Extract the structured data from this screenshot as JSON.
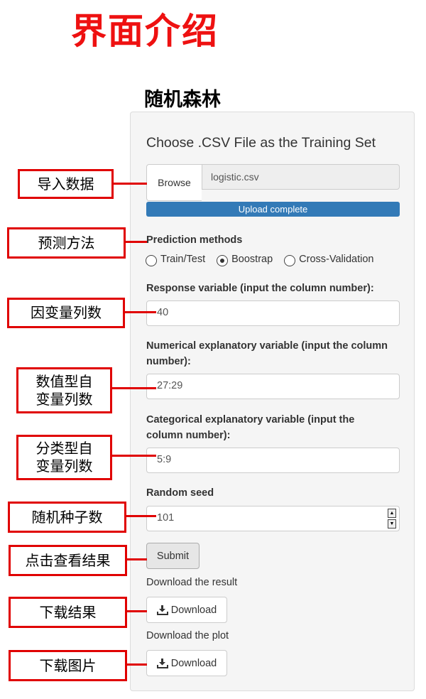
{
  "page": {
    "title": "界面介绍",
    "subtitle": "随机森林"
  },
  "panel": {
    "file_heading": "Choose .CSV File as the Training Set",
    "browse_label": "Browse",
    "file_name": "logistic.csv",
    "upload_status": "Upload complete",
    "upload_progress_percent": 100,
    "prediction_methods_label": "Prediction methods",
    "prediction_options": [
      "Train/Test",
      "Boostrap",
      "Cross-Validation"
    ],
    "prediction_selected": "Boostrap",
    "response_label": "Response variable (input the column number):",
    "response_value": "40",
    "numerical_label": "Numerical explanatory variable (input the column number):",
    "numerical_value": "27:29",
    "categorical_label": "Categorical explanatory variable (input the column number):",
    "categorical_value": "5:9",
    "seed_label": "Random seed",
    "seed_value": "101",
    "submit_label": "Submit",
    "download_result_label": "Download the result",
    "download_plot_label": "Download the plot",
    "download_button_label": "Download"
  },
  "callouts": {
    "import_data": "导入数据",
    "prediction_method": "预测方法",
    "response_columns": "因变量列数",
    "numerical_columns": "数值型自\n变量列数",
    "categorical_columns": "分类型自\n变量列数",
    "random_seed": "随机种子数",
    "view_result": "点击查看结果",
    "download_result": "下载结果",
    "download_image": "下载图片"
  },
  "colors": {
    "annotation_red": "#e00000",
    "title_red": "#ee1111",
    "progress_blue": "#337ab7"
  }
}
